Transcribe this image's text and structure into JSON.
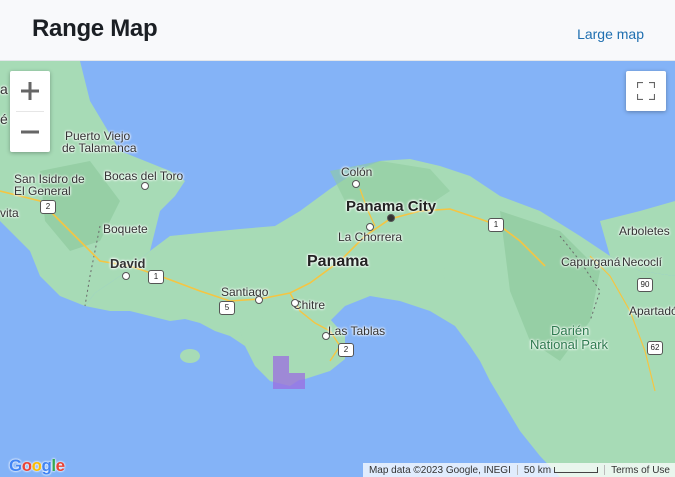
{
  "header": {
    "title": "Range Map",
    "large_map_link": "Large map"
  },
  "map": {
    "water_color": "#84b3f7",
    "land_color": "#a7dbb6",
    "range_color": "#9b6ee0",
    "controls": {
      "zoom_in": "+",
      "zoom_out": "−",
      "fullscreen_icon": "fullscreen-icon"
    },
    "labels": {
      "puerto_viejo": "Puerto Viejo",
      "de_talamanca": "de Talamanca",
      "san_isidro": "San Isidro de",
      "el_general": "El General",
      "bocas": "Bocas del Toro",
      "boquete": "Boquete",
      "david": "David",
      "colon": "Colón",
      "panama_city": "Panama City",
      "la_chorrera": "La Chorrera",
      "panama": "Panama",
      "santiago": "Santiago",
      "chitre": "Chitre",
      "las_tablas": "Las Tablas",
      "arboletes": "Arboletes",
      "capurgana": "Capurganá",
      "necocli": "Necoclí",
      "apartado": "Apartadó",
      "darien": "Darién",
      "national_park": "National Park",
      "edge_a": "a",
      "edge_e": "é",
      "edge_vita": "vita"
    },
    "shields": [
      "2",
      "1",
      "5",
      "2",
      "1",
      "90",
      "62"
    ],
    "footer": {
      "map_data": "Map data ©2023 Google, INEGI",
      "scale": "50 km",
      "terms": "Terms of Use"
    },
    "logo": "Google"
  }
}
